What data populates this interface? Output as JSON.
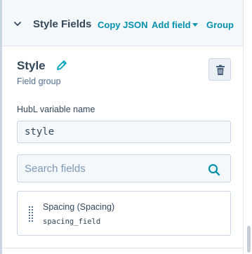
{
  "header": {
    "title": "Style Fields",
    "copy_json": "Copy JSON",
    "add_field": "Add field",
    "group": "Group"
  },
  "group": {
    "name": "Style",
    "type_label": "Field group"
  },
  "hubl": {
    "label": "HubL variable name",
    "value": "style"
  },
  "search": {
    "placeholder": "Search fields"
  },
  "fields": [
    {
      "label": "Spacing (Spacing)",
      "code": "spacing_field"
    }
  ],
  "colors": {
    "accent": "#0091ae",
    "text": "#33475b",
    "header_bg": "#f5f8fa",
    "border": "#cbd6e2",
    "edit_icon": "#00a4bd"
  },
  "icons": {
    "collapse": "chevron-down-icon",
    "edit": "pencil-icon",
    "delete": "trash-icon",
    "search": "search-icon",
    "drag": "drag-handle-icon"
  }
}
